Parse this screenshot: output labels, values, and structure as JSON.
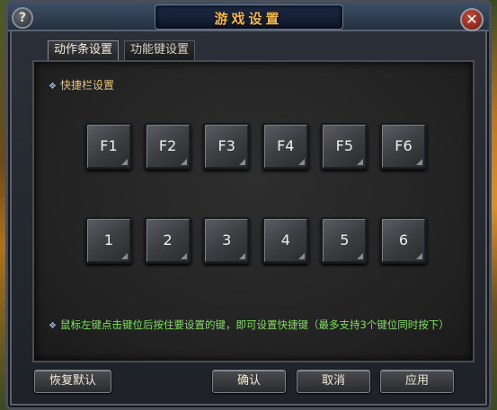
{
  "window": {
    "title": "游戏设置",
    "help_glyph": "?",
    "close_glyph": "✕"
  },
  "tabs": [
    {
      "label": "动作条设置",
      "active": true
    },
    {
      "label": "功能键设置",
      "active": false
    }
  ],
  "section": {
    "label": "快捷栏设置",
    "bullet": "❖"
  },
  "keys": {
    "function_row": [
      "F1",
      "F2",
      "F3",
      "F4",
      "F5",
      "F6"
    ],
    "number_row": [
      "1",
      "2",
      "3",
      "4",
      "5",
      "6"
    ]
  },
  "hint": "鼠标左键点击键位后按住要设置的键，即可设置快捷键（最多支持3个键位同时按下）",
  "buttons": {
    "restore_default": "恢复默认",
    "confirm": "确认",
    "cancel": "取消",
    "apply": "应用"
  },
  "colors": {
    "title": "#f0b84a",
    "section_label": "#e8c27a",
    "hint": "#7fe05a"
  },
  "icons": {
    "help": "help-icon",
    "close": "close-icon",
    "bullet": "diamond-bullet-icon"
  }
}
